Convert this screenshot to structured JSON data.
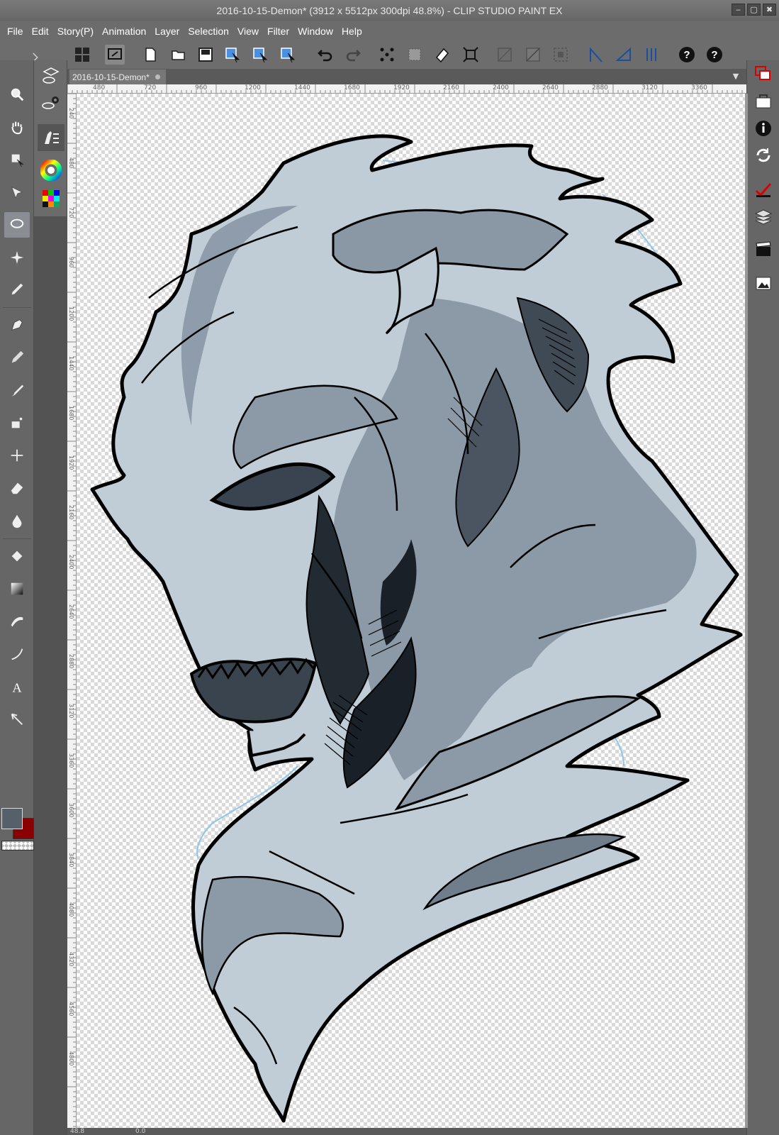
{
  "window": {
    "title": "2016-10-15-Demon* (3912 x 5512px 300dpi 48.8%)  - CLIP STUDIO PAINT EX",
    "minimize_glyph": "‒",
    "maximize_glyph": "▢",
    "close_glyph": "✖"
  },
  "menu": {
    "items": [
      "File",
      "Edit",
      "Story(P)",
      "Animation",
      "Layer",
      "Selection",
      "View",
      "Filter",
      "Window",
      "Help"
    ]
  },
  "command_bar": {
    "icons": [
      "clip-studio-icon",
      "show-tool-icon",
      "new-icon",
      "open-icon",
      "save-icon",
      "select-layer-icon",
      "select-layer-2-icon",
      "select-layer-3-icon",
      "undo-icon",
      "redo-icon",
      "transform-dots-icon",
      "fill-icon",
      "erase-icon",
      "scale-icon",
      "snap-ruler-icon",
      "snap-grid-icon",
      "snap-special-icon",
      "ruler-icon",
      "perspective-icon",
      "special-ruler-icon",
      "help-icon",
      "help-2-icon"
    ]
  },
  "document": {
    "tab_label": "2016-10-15-Demon*",
    "dropdown_glyph": "▼"
  },
  "ruler": {
    "top_labels": [
      "480",
      "720",
      "960",
      "1200",
      "1440",
      "1680",
      "1920",
      "2160",
      "2400",
      "2640",
      "2880",
      "3120",
      "3360"
    ],
    "left_labels": [
      "240",
      "480",
      "720",
      "960",
      "1200",
      "1440",
      "1680",
      "1920",
      "2160",
      "2400",
      "2640",
      "2880",
      "3120",
      "3360",
      "3600",
      "3840",
      "4080",
      "4320",
      "4560",
      "4800"
    ]
  },
  "tools": {
    "items": [
      "zoom-icon",
      "hand-icon",
      "move-icon",
      "object-icon",
      "lasso-icon",
      "auto-select-icon",
      "eyedropper-icon",
      "pen-icon",
      "pencil-icon",
      "brush-icon",
      "airbrush-icon",
      "decoration-icon",
      "eraser-icon",
      "blend-icon",
      "fill-bucket-icon",
      "gradient-icon",
      "figure-icon",
      "curve-icon",
      "text-icon",
      "balloon-icon"
    ]
  },
  "colors": {
    "main": "#55606a",
    "sub": "#8b0000"
  },
  "status": {
    "zoom": "48.8",
    "angle": "0.0"
  }
}
